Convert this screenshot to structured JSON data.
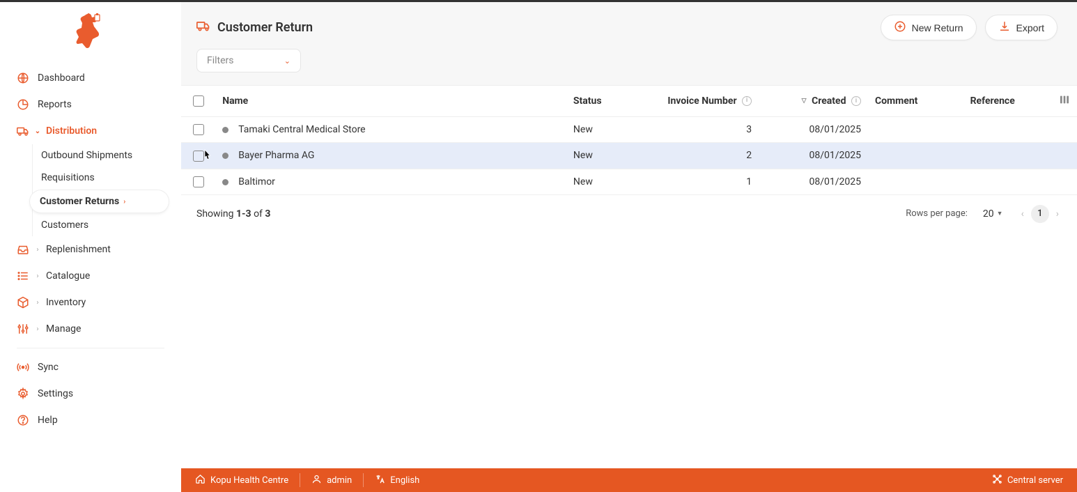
{
  "page": {
    "title": "Customer Return"
  },
  "actions": {
    "new_return": "New Return",
    "export": "Export"
  },
  "filters": {
    "label": "Filters"
  },
  "sidebar": {
    "items": [
      {
        "label": "Dashboard"
      },
      {
        "label": "Reports"
      },
      {
        "label": "Distribution"
      },
      {
        "label": "Replenishment"
      },
      {
        "label": "Catalogue"
      },
      {
        "label": "Inventory"
      },
      {
        "label": "Manage"
      },
      {
        "label": "Sync"
      },
      {
        "label": "Settings"
      },
      {
        "label": "Help"
      }
    ],
    "distribution_sub": [
      {
        "label": "Outbound Shipments"
      },
      {
        "label": "Requisitions"
      },
      {
        "label": "Customer Returns"
      },
      {
        "label": "Customers"
      }
    ]
  },
  "table": {
    "headers": {
      "name": "Name",
      "status": "Status",
      "invoice": "Invoice Number",
      "created": "Created",
      "comment": "Comment",
      "reference": "Reference"
    },
    "rows": [
      {
        "name": "Tamaki Central Medical Store",
        "status": "New",
        "invoice": "3",
        "created": "08/01/2025",
        "comment": "",
        "reference": ""
      },
      {
        "name": "Bayer Pharma AG",
        "status": "New",
        "invoice": "2",
        "created": "08/01/2025",
        "comment": "",
        "reference": ""
      },
      {
        "name": "Baltimor",
        "status": "New",
        "invoice": "1",
        "created": "08/01/2025",
        "comment": "",
        "reference": ""
      }
    ]
  },
  "pagination": {
    "showing_prefix": "Showing ",
    "range": "1-3",
    "of": " of ",
    "total": "3",
    "rows_per_page_label": "Rows per page:",
    "rows_per_page_value": "20",
    "current_page": "1"
  },
  "footer": {
    "store": "Kopu Health Centre",
    "user": "admin",
    "language": "English",
    "server": "Central server"
  }
}
